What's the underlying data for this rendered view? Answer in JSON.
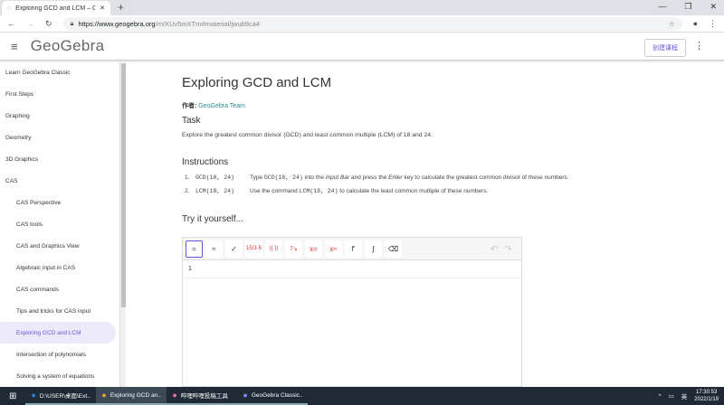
{
  "browser": {
    "tab_title": "Exploring GCD and LCM – Ge",
    "url_host": "https://www.geogebra.org",
    "url_path": "/m/XUv5mXTm#material/jwub9ca4"
  },
  "header": {
    "logo": "GeoGebra",
    "course_button": "创建课程"
  },
  "sidebar": {
    "items": [
      {
        "label": "Learn GeoGebra Classic",
        "sub": false
      },
      {
        "label": "First Steps",
        "sub": false
      },
      {
        "label": "Graphing",
        "sub": false
      },
      {
        "label": "Geometry",
        "sub": false
      },
      {
        "label": "3D Graphics",
        "sub": false
      },
      {
        "label": "CAS",
        "sub": false
      },
      {
        "label": "CAS Perspective",
        "sub": true
      },
      {
        "label": "CAS tools",
        "sub": true
      },
      {
        "label": "CAS and Graphics View",
        "sub": true
      },
      {
        "label": "Algebraic input in CAS",
        "sub": true
      },
      {
        "label": "CAS commands",
        "sub": true
      },
      {
        "label": "Tips and tricks for CAS input",
        "sub": true
      },
      {
        "label": "Exploring GCD and LCM",
        "sub": true,
        "active": true
      },
      {
        "label": "Intersection of polynomials",
        "sub": true
      },
      {
        "label": "Solving a system of equations",
        "sub": true
      }
    ]
  },
  "main": {
    "title": "Exploring GCD and LCM",
    "author_label": "作者:",
    "author": "GeoGebra Team",
    "task_heading": "Task",
    "task_text": "Explore the greatest common divisor (GCD) and least common multiple (LCM) of 18 and 24.",
    "instructions_heading": "Instructions",
    "instructions": [
      {
        "num": "1.",
        "cmd": "GCD(18, 24)",
        "pre": "Type ",
        "code": "GCD(18, 24)",
        "mid": " into the ",
        "em1": "Input Bar",
        "mid2": " and press the ",
        "em2": "Enter",
        "post": " key to calculate the greatest common divisor of these numbers."
      },
      {
        "num": "2.",
        "cmd": "LCM(18, 24)",
        "pre": "Use the command ",
        "code": "LCM(18, 24)",
        "mid": " to calculate the least common multiple of these numbers.",
        "em1": "",
        "mid2": "",
        "em2": "",
        "post": ""
      }
    ],
    "try_heading": "Try it yourself...",
    "toolbar": [
      "=",
      "≈",
      "✓",
      "15/3·5",
      "(( ))",
      "7↘",
      "x=",
      "x≈",
      "f'",
      "∫",
      "⌫"
    ],
    "row_number": "1"
  },
  "taskbar": {
    "items": [
      "D:\\USER\\桌面\\Ext...",
      "Exploring GCD an...",
      "哔哩哔哩投稿工具",
      "GeoGebra Classic..."
    ],
    "time": "17:30:53",
    "date": "2022/1/19"
  }
}
